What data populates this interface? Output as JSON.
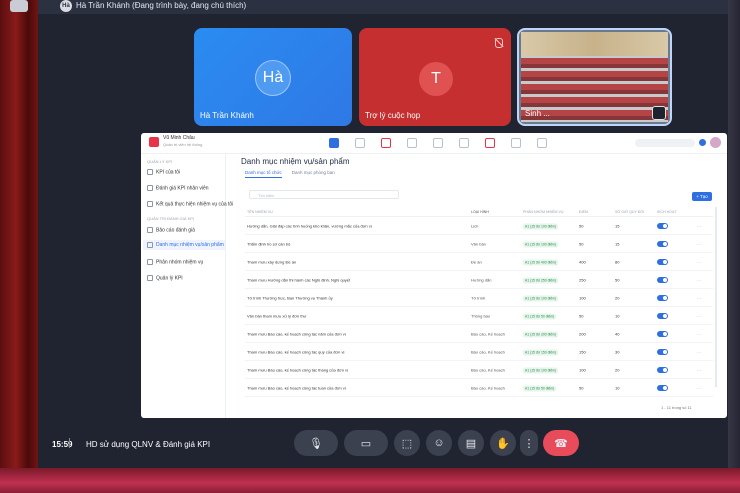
{
  "meet": {
    "presenter_initial": "Hà",
    "presenter_banner": "Hà Trần Khánh (Đang trình bày, đang chú thích)",
    "tiles": [
      {
        "initial": "Hà",
        "name": "Hà Trần Khánh",
        "color": "#2a8cf0"
      },
      {
        "initial": "T",
        "name": "Trợ lý cuộc họp",
        "color": "#c62f2f"
      },
      {
        "name": "Sinh ... ",
        "color": "#6b7a88"
      }
    ],
    "clock": "15:59",
    "meeting_title": "HD sử dụng QLNV & Đánh giá KPI",
    "controls": [
      "mic-level",
      "mic",
      "chevron-up",
      "camera",
      "present",
      "emoji",
      "captions",
      "raise-hand",
      "more",
      "end-call"
    ]
  },
  "app": {
    "user": "Vũ Minh Châu",
    "user_sub": "Quản trị viên hệ thống",
    "sidebar": {
      "section_1": "QUẢN LÝ KPI",
      "items_1": [
        "KPI của tôi",
        "Đánh giá KPI nhân viên",
        "Kết quả thực hiện nhiệm vụ của tôi"
      ],
      "section_2": "QUẢN TRỊ ĐÁNH GIÁ KPI",
      "items_2": [
        "Bảo cáo đánh giá",
        "Danh mục nhiệm vụ/sản phẩm",
        "Phân nhóm nhiệm vụ",
        "Quản lý KPI"
      ]
    },
    "page_title": "Danh mục nhiệm vụ/sản phẩm",
    "tabs": [
      "Danh mục tổ chức",
      "Danh mục phòng ban"
    ],
    "search_placeholder": "Tìm kiếm",
    "add_button": "+ Tạo",
    "columns": [
      "TÊN NHIỆM VỤ",
      "LOẠI HÌNH",
      "PHÂN NHÓM NHIỆM VỤ",
      "ĐIỂM",
      "SỐ GIỜ QUY ĐỔI",
      "KÍCH HOẠT",
      ""
    ],
    "rows": [
      {
        "name": "Hướng dẫn, Giải đáp các tình huống khó khăn, vướng mắc của đơn vị",
        "type": "Lịch",
        "kpi": "A1 (15 đơ 100 điểm)",
        "score": "50",
        "hours": "15"
      },
      {
        "name": "Thẩm định hồ sơ cán bộ",
        "type": "Văn bản",
        "kpi": "A1 (15 đơ 100 điểm)",
        "score": "50",
        "hours": "15"
      },
      {
        "name": "Tham mưu xây dựng Đề án",
        "type": "Đề án",
        "kpi": "A1 (15 đơ 400 điểm)",
        "score": "400",
        "hours": "80"
      },
      {
        "name": "Tham mưu Hướng dẫn thi hành các Nghị định, Nghị quyết",
        "type": "Hướng dẫn",
        "kpi": "A1 (15 đơ 250 điểm)",
        "score": "250",
        "hours": "50"
      },
      {
        "name": "Tờ trình Thường trực, Ban Thường vụ Thành ủy",
        "type": "Tờ trình",
        "kpi": "A1 (15 đơ 100 điểm)",
        "score": "100",
        "hours": "20"
      },
      {
        "name": "Văn bản tham mưu xử lý đơn thư",
        "type": "Thông báo",
        "kpi": "A1 (15 đơ 50 điểm)",
        "score": "50",
        "hours": "10"
      },
      {
        "name": "Tham mưu Báo cáo, kế hoạch công tác năm của đơn vị",
        "type": "Báo cáo, Kế hoạch",
        "kpi": "A1 (15 đơ 200 điểm)",
        "score": "200",
        "hours": "40"
      },
      {
        "name": "Tham mưu Báo cáo, kế hoạch công tác quý của đơn vị",
        "type": "Báo cáo, Kế hoạch",
        "kpi": "A1 (15 đơ 150 điểm)",
        "score": "150",
        "hours": "30"
      },
      {
        "name": "Tham mưu Báo cáo, kế hoạch công tác tháng của đơn vị",
        "type": "Báo cáo, Kế hoạch",
        "kpi": "A1 (15 đơ 100 điểm)",
        "score": "100",
        "hours": "20"
      },
      {
        "name": "Tham mưu Báo cáo, kế hoạch công tác tuần của đơn vị",
        "type": "Báo cáo, Kế hoạch",
        "kpi": "A1 (15 đơ 50 điểm)",
        "score": "50",
        "hours": "10"
      }
    ],
    "pager": "1 - 11 trong số 11"
  }
}
